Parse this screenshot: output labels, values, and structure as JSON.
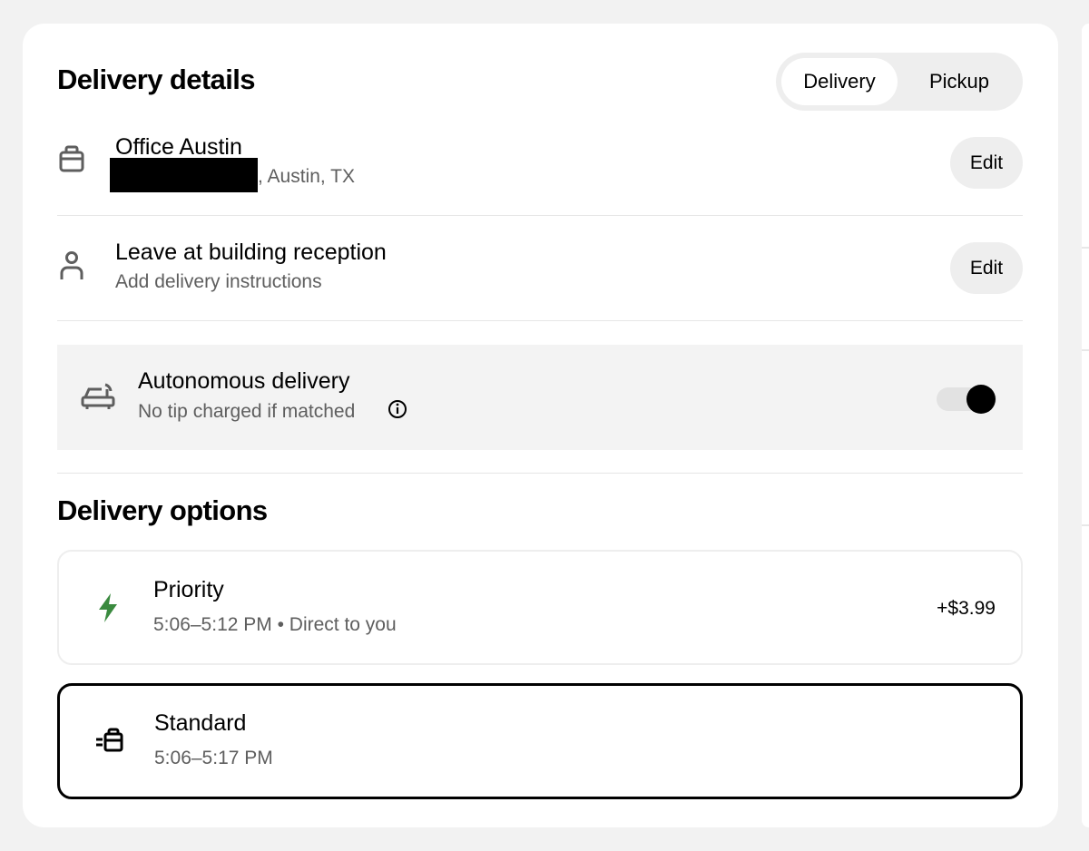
{
  "delivery_details": {
    "title": "Delivery details",
    "mode_toggle": {
      "options": [
        "Delivery",
        "Pickup"
      ],
      "selected": "Delivery"
    },
    "address": {
      "name": "Office Austin",
      "line": ", Austin, TX",
      "edit_label": "Edit",
      "icon": "bag-icon"
    },
    "dropoff": {
      "title": "Leave at building reception",
      "subtitle": "Add delivery instructions",
      "edit_label": "Edit",
      "icon": "person-icon"
    },
    "autonomous": {
      "title": "Autonomous delivery",
      "subtitle": "No tip charged if matched",
      "enabled": true,
      "icon": "robot-car-icon"
    }
  },
  "delivery_options": {
    "title": "Delivery options",
    "options": [
      {
        "name": "Priority",
        "detail": "5:06–5:12 PM • Direct to you",
        "price": "+$3.99",
        "icon": "lightning-icon",
        "icon_color": "#3a8a3f",
        "selected": false
      },
      {
        "name": "Standard",
        "detail": "5:06–5:17 PM",
        "price": "",
        "icon": "fast-bag-icon",
        "selected": true
      }
    ]
  }
}
